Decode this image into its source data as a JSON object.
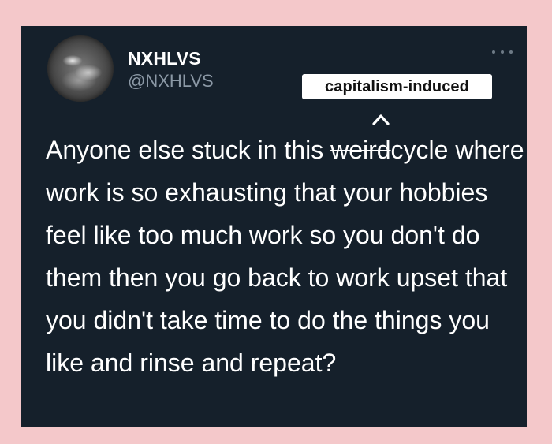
{
  "colors": {
    "page_background": "#f4c8ca",
    "card_background": "#15202b",
    "text_primary": "#ffffff",
    "text_secondary": "#8b98a5",
    "badge_background": "#ffffff",
    "badge_text": "#111111"
  },
  "tweet": {
    "display_name": "NXHLVS",
    "handle": "@NXHLVS",
    "avatar_icon": "avatar-photo",
    "more_icon": "more-options-icon",
    "text_before_strike": "Anyone else stuck in this ",
    "struck_word": "weird",
    "text_after_strike": "cycle where work is so exhausting that your hobbies feel like too much work so you don't do them then you go back to work upset that you didn't take time to do the things you like and rinse and repeat?"
  },
  "annotation": {
    "label": "capitalism-induced",
    "insertion_mark": "^"
  }
}
